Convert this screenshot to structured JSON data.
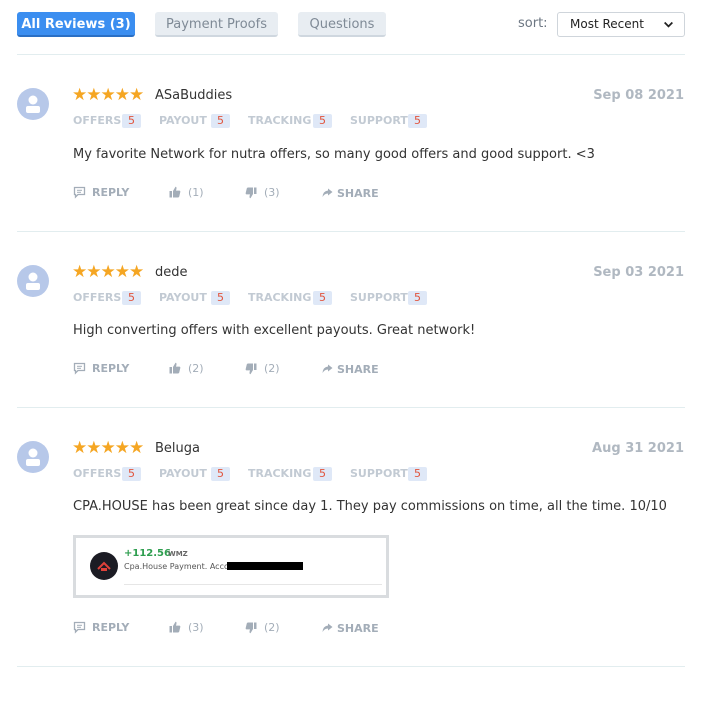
{
  "tabs": [
    {
      "label": "All Reviews (3)"
    },
    {
      "label": "Payment Proofs"
    },
    {
      "label": "Questions"
    }
  ],
  "sort": {
    "label": "sort:",
    "value": "Most Recent"
  },
  "rating_labels": {
    "offers": "OFFERS",
    "payout": "PAYOUT",
    "tracking": "TRACKING",
    "support": "SUPPORT"
  },
  "actions": {
    "reply": "REPLY",
    "share": "SHARE"
  },
  "colors": {
    "accent": "#3b8ef0",
    "star": "#f5a623",
    "badge_text": "#e1543d",
    "badge_bg": "#dfe8f7"
  },
  "reviews": [
    {
      "stars": "★★★★★",
      "rating": 5,
      "user": "ASaBuddies",
      "date": "Sep 08 2021",
      "offers": "5",
      "payout": "5",
      "tracking": "5",
      "support": "5",
      "text": "My favorite Network for nutra offers, so many good offers and good support. <3",
      "likes": "(1)",
      "dislikes": "(3)"
    },
    {
      "stars": "★★★★★",
      "rating": 5,
      "user": "dede",
      "date": "Sep 03 2021",
      "offers": "5",
      "payout": "5",
      "tracking": "5",
      "support": "5",
      "text": "High converting offers with excellent payouts. Great network!",
      "likes": "(2)",
      "dislikes": "(2)"
    },
    {
      "stars": "★★★★★",
      "rating": 5,
      "user": "Beluga",
      "date": "Aug 31 2021",
      "offers": "5",
      "payout": "5",
      "tracking": "5",
      "support": "5",
      "text": "CPA.HOUSE has been great since day 1. They pay commissions on time, all the time. 10/10",
      "likes": "(3)",
      "dislikes": "(2)",
      "proof": {
        "amount": "+112.56",
        "currency": "WMZ",
        "description": "Cpa.House Payment. Account"
      }
    }
  ]
}
